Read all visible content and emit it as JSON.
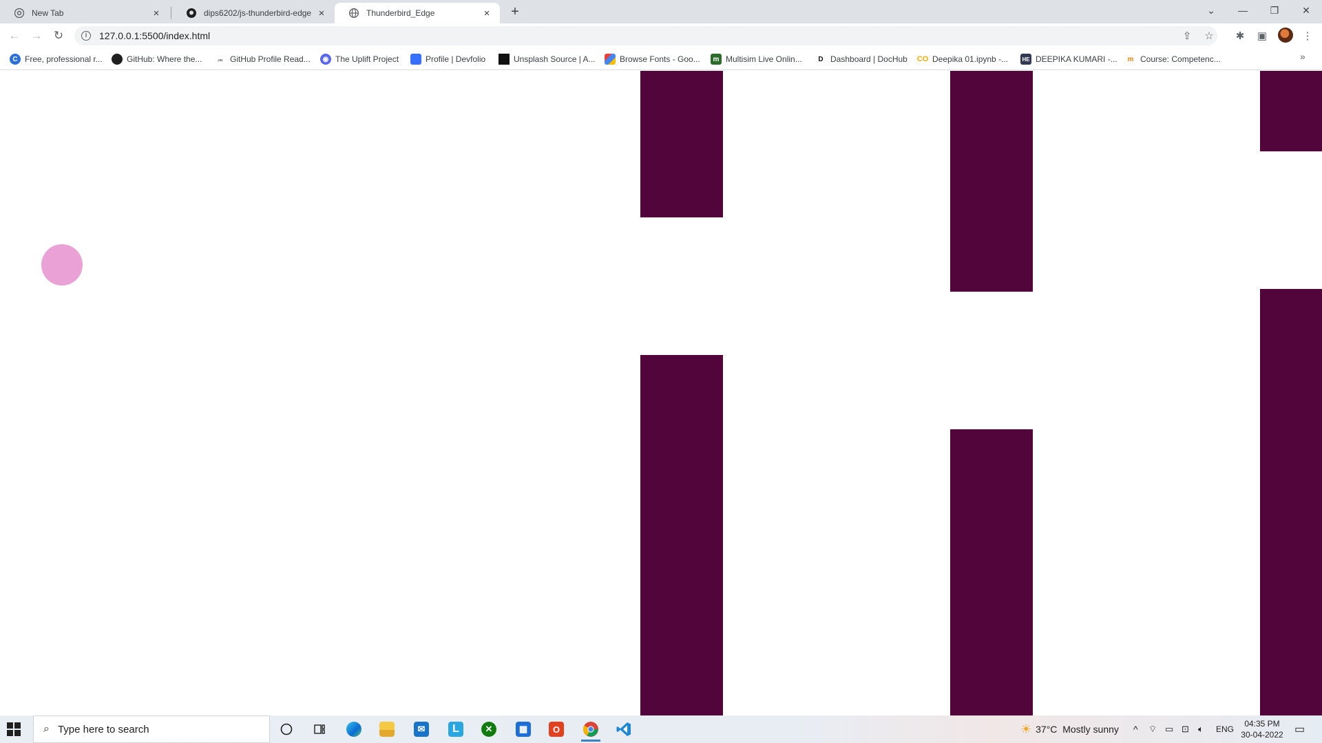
{
  "browser": {
    "tabs": [
      {
        "label": "New Tab",
        "icon": "chrome-icon",
        "active": false
      },
      {
        "label": "dips6202/js-thunderbird-edge",
        "icon": "github-icon",
        "active": false
      },
      {
        "label": "Thunderbird_Edge",
        "icon": "globe-icon",
        "active": true
      }
    ],
    "url": "127.0.0.1:5500/index.html",
    "bookmarks": [
      {
        "label": "Free, professional r...",
        "icon": "canva-icon",
        "color": "#2a6fdb"
      },
      {
        "label": "GitHub: Where the...",
        "icon": "github-icon",
        "color": "#1f1f1f"
      },
      {
        "label": "GitHub Profile Read...",
        "icon": "readme-icon",
        "color": "#555555"
      },
      {
        "label": "The Uplift Project",
        "icon": "discord-icon",
        "color": "#5865f2"
      },
      {
        "label": "Profile | Devfolio",
        "icon": "devfolio-icon",
        "color": "#3770ff"
      },
      {
        "label": "Unsplash Source | A...",
        "icon": "unsplash-icon",
        "color": "#111111"
      },
      {
        "label": "Browse Fonts - Goo...",
        "icon": "google-fonts-icon",
        "color": "#ea4335"
      },
      {
        "label": "Multisim Live Onlin...",
        "icon": "multisim-icon",
        "color": "#2b6b2b"
      },
      {
        "label": "Dashboard | DocHub",
        "icon": "dochub-icon",
        "color": "#111111"
      },
      {
        "label": "Deepika 01.ipynb -...",
        "icon": "colab-icon",
        "color": "#f9ab00"
      },
      {
        "label": "DEEPIKA KUMARI -...",
        "icon": "hackerearth-icon",
        "color": "#323754"
      },
      {
        "label": "Course: Competenc...",
        "icon": "moodle-icon",
        "color": "#f98012"
      }
    ]
  },
  "game": {
    "title": "Thunderbird_Edge",
    "pipe_color": "#52053a",
    "bird_color": "#eaa2d6",
    "background": "#ffffff"
  },
  "taskbar": {
    "search_placeholder": "Type here to search",
    "apps": [
      "cortana-icon",
      "task-view-icon",
      "edge-icon",
      "file-explorer-icon",
      "mail-icon",
      "l-app-icon",
      "xbox-icon",
      "store-icon",
      "office-icon",
      "chrome-icon",
      "vscode-icon"
    ],
    "weather": "37°C  Mostly sunny",
    "language": "ENG",
    "time": "04:35 PM",
    "date": "30-04-2022"
  }
}
